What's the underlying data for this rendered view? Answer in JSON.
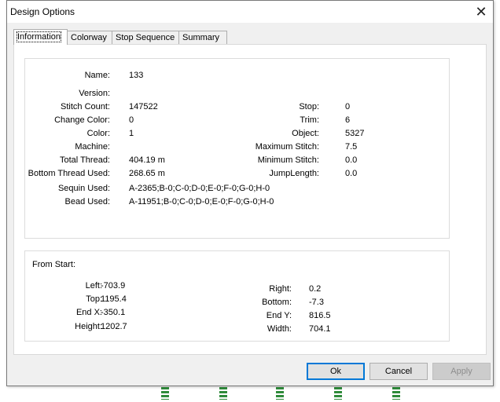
{
  "window": {
    "title": "Design Options"
  },
  "tabs": [
    "Information",
    "Colorway",
    "Stop Sequence",
    "Summary"
  ],
  "info": {
    "left_column": [
      {
        "label": "Name:",
        "value": "133"
      },
      {
        "label": "Version:",
        "value": ""
      },
      {
        "label": "Stitch Count:",
        "value": "147522"
      },
      {
        "label": "Change Color:",
        "value": "0"
      },
      {
        "label": "Color:",
        "value": "1"
      },
      {
        "label": "Machine:",
        "value": ""
      },
      {
        "label": "Total Thread:",
        "value": "404.19 m"
      },
      {
        "label": "Bottom Thread Used:",
        "value": "268.65 m"
      },
      {
        "label": "Sequin Used:",
        "value": "A-2365;B-0;C-0;D-0;E-0;F-0;G-0;H-0"
      },
      {
        "label": "Bead Used:",
        "value": "A-11951;B-0;C-0;D-0;E-0;F-0;G-0;H-0"
      }
    ],
    "right_column": [
      {
        "label": "Stop:",
        "value": "0"
      },
      {
        "label": "Trim:",
        "value": "6"
      },
      {
        "label": "Object:",
        "value": "5327"
      },
      {
        "label": "Maximum Stitch:",
        "value": "7.5"
      },
      {
        "label": "Minimum Stitch:",
        "value": "0.0"
      },
      {
        "label": "JumpLength:",
        "value": "0.0"
      }
    ]
  },
  "from_start": {
    "heading": "From Start:",
    "left": [
      {
        "label": "Left:",
        "value": "-703.9"
      },
      {
        "label": "Top:",
        "value": "1195.4"
      },
      {
        "label": "End X:",
        "value": "-350.1"
      },
      {
        "label": "Height:",
        "value": "1202.7"
      }
    ],
    "right": [
      {
        "label": "Right:",
        "value": "0.2"
      },
      {
        "label": "Bottom:",
        "value": "-7.3"
      },
      {
        "label": "End Y:",
        "value": "816.5"
      },
      {
        "label": "Width:",
        "value": "704.1"
      }
    ]
  },
  "buttons": {
    "ok": "Ok",
    "cancel": "Cancel",
    "apply": "Apply"
  },
  "icons": {
    "close": "close-icon"
  },
  "colors": {
    "accent": "#0078d7",
    "decor": "#2e8b3a"
  }
}
